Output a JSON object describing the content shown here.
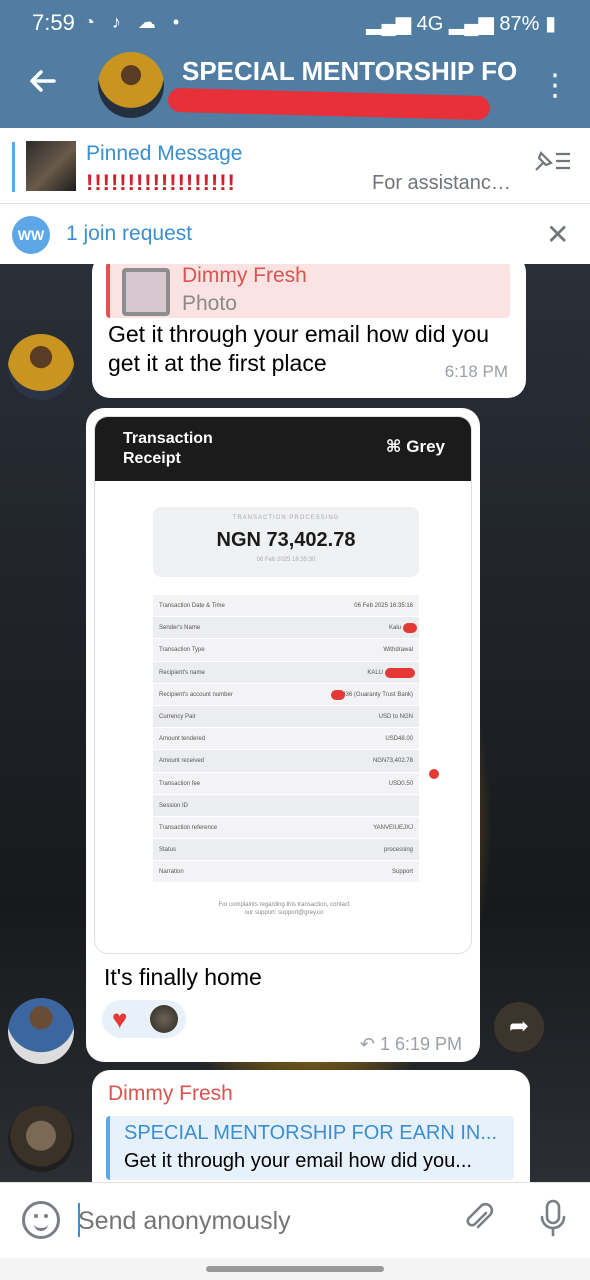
{
  "status": {
    "time": "7:59",
    "network": "4G",
    "battery": "87%"
  },
  "header": {
    "title": "SPECIAL MENTORSHIP FO"
  },
  "pinned": {
    "label": "Pinned Message",
    "marks": "!!!!!!!!!!!!!!!!!!",
    "preview": "For assistanc…"
  },
  "join": {
    "badge": "WW",
    "text": "1 join request"
  },
  "messages": {
    "m1": {
      "reply_name": "Dimmy Fresh",
      "reply_sub": "Photo",
      "text": "Get it through your email how did you get it at the first place",
      "time": "6:18 PM"
    },
    "m2": {
      "receipt": {
        "title": "Transaction Receipt",
        "brand": "Grey",
        "status_label": "TRANSACTION PROCESSING",
        "amount": "NGN 73,402.78",
        "date": "06 Feb 2025 16:35:30",
        "rows": [
          {
            "k": "Transaction Date & Time",
            "v": "06 Feb 2025 16:35:16"
          },
          {
            "k": "Sender's Name",
            "v": "Kalu"
          },
          {
            "k": "Transaction Type",
            "v": "Withdrawal"
          },
          {
            "k": "Recipient's name",
            "v": "KALU"
          },
          {
            "k": "Recipient's account number",
            "v": "004436 (Guaranty Trust Bank)"
          },
          {
            "k": "Currency Pair",
            "v": "USD to NGN"
          },
          {
            "k": "Amount tendered",
            "v": "USD48.00"
          },
          {
            "k": "Amount received",
            "v": "NGN73,402.78"
          },
          {
            "k": "Transaction fee",
            "v": "USD0.50"
          },
          {
            "k": "Session ID",
            "v": ""
          },
          {
            "k": "Transaction reference",
            "v": "YANVEIUEJXJ"
          },
          {
            "k": "Status",
            "v": "processing"
          },
          {
            "k": "Narration",
            "v": "Support"
          }
        ],
        "footer": "For complaints regarding this transaction, contact our support: support@grey.co"
      },
      "text": "It's finally home",
      "meta": "↶ 1  6:19 PM"
    },
    "m3": {
      "sender": "Dimmy Fresh",
      "fwd_title": "SPECIAL MENTORSHIP FOR EARN IN...",
      "fwd_text": "Get it through your email how did you..."
    }
  },
  "composer": {
    "placeholder": "Send anonymously"
  },
  "colors": {
    "header": "#517da2",
    "accent": "#3a8ed1",
    "reply_red": "#d9534f"
  }
}
